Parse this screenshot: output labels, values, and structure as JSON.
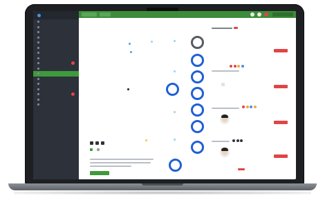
{
  "sidebar": {
    "logo_text": "",
    "items": [
      "",
      "",
      "",
      "",
      "",
      "",
      "",
      "",
      "",
      "",
      "",
      "",
      "",
      "",
      "",
      "",
      ""
    ]
  },
  "topbar": {
    "right_button": ""
  },
  "main": {
    "breadcrumb": "",
    "green_button": ""
  },
  "panel": {
    "people": [
      {
        "name": "",
        "sub": ""
      },
      {
        "name": "",
        "sub": ""
      },
      {
        "name": "",
        "sub": ""
      },
      {
        "name": "",
        "sub": ""
      }
    ]
  },
  "colors": {
    "sidebar_bg": "#2c313a",
    "topbar": "#3c8c3a",
    "accent_ring": "#1f5fd6",
    "red_button": "#e04545"
  }
}
